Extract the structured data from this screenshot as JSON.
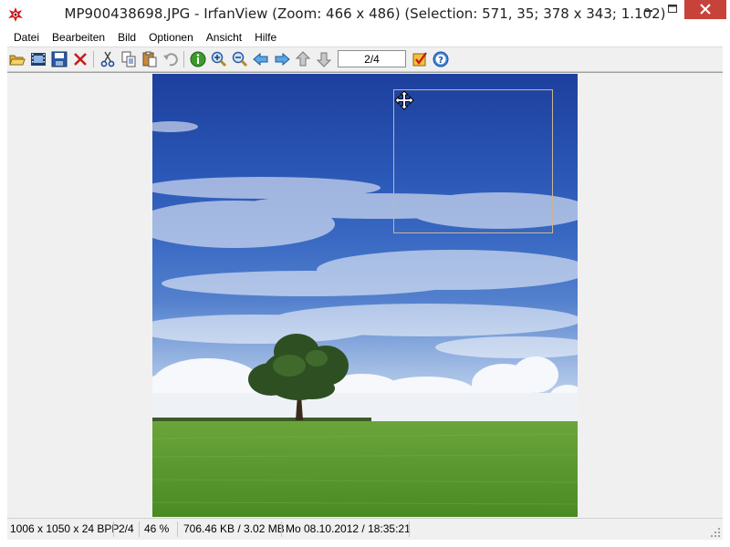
{
  "window": {
    "title": "MP900438698.JPG - IrfanView (Zoom: 466 x 486) (Selection: 571, 35; 378 x 343; 1.102)",
    "buttons": [
      "minimize",
      "maximize",
      "close"
    ],
    "close_color": "#c7423b"
  },
  "menu": {
    "items": [
      "Datei",
      "Bearbeiten",
      "Bild",
      "Optionen",
      "Ansicht",
      "Hilfe"
    ]
  },
  "toolbar": {
    "icons": [
      "open-folder-icon",
      "slideshow-icon",
      "save-icon",
      "delete-icon",
      "cut-icon",
      "copy-icon",
      "paste-icon",
      "undo-icon",
      "info-icon",
      "zoom-in-icon",
      "zoom-out-icon",
      "previous-icon",
      "next-icon",
      "first-page-icon",
      "last-page-icon",
      "page-field",
      "properties-icon",
      "help-icon"
    ],
    "page_value": "2/4"
  },
  "statusbar": {
    "dimensions": "1006 x 1050 x 24 BPP",
    "page": "2/4",
    "zoom": "46 %",
    "size": "706.46 KB / 3.02 MB",
    "date": "Mo 08.10.2012 / 18:35:21"
  },
  "colors": {
    "sky_top": "#1d3f9c",
    "grass": "#5a9a2e",
    "selection_border": "#c9b596"
  }
}
